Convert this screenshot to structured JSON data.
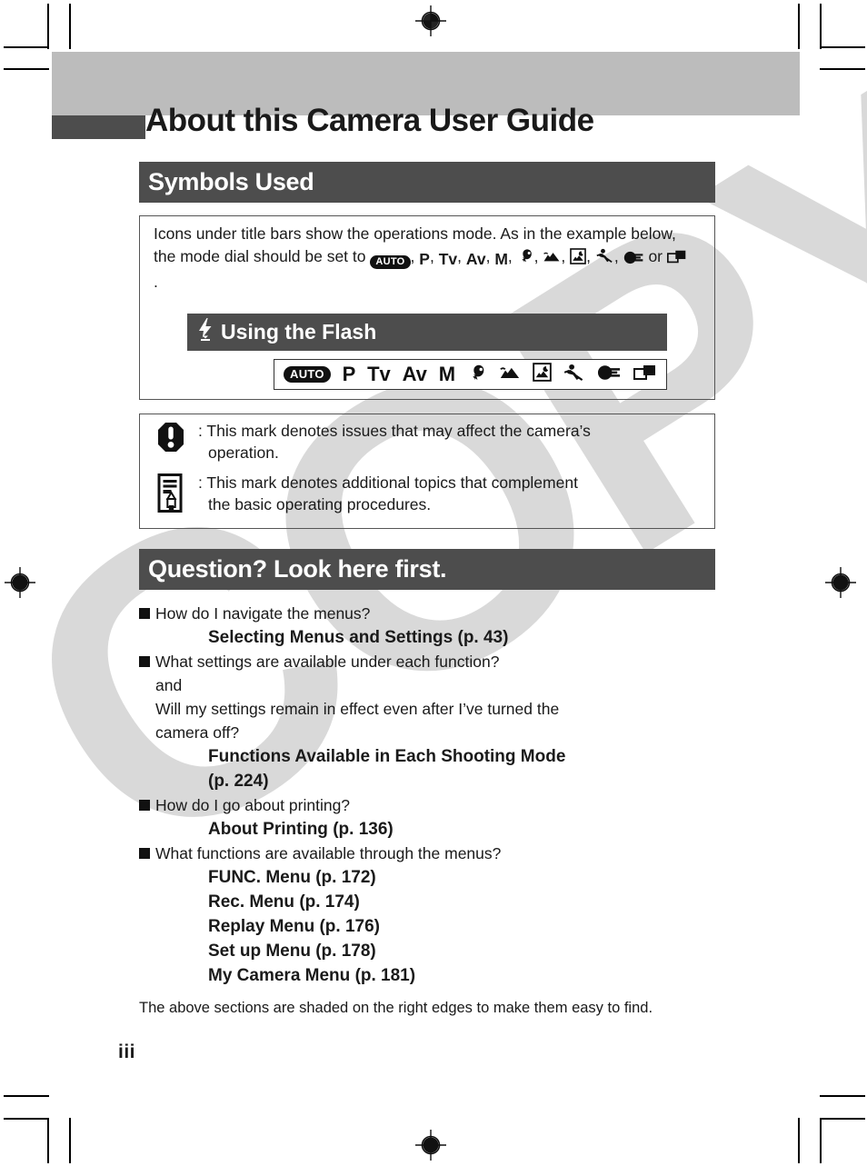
{
  "page": {
    "title": "About this Camera User Guide",
    "folio": "iii",
    "watermark": "COPY"
  },
  "sections": {
    "symbols": {
      "bar_label": "Symbols Used",
      "intro_prefix": "Icons under title bars show the operations mode. As in the example below, the mode dial should be set to ",
      "intro_after_auto": ", ",
      "intro_mid": " or ",
      "intro_end": ".",
      "auto_label": "AUTO",
      "mode_text_labels": [
        "P",
        "Tv",
        "Av",
        "M"
      ],
      "example": {
        "bar_label": "Using the Flash",
        "flash_icon": "flash-icon",
        "modes": [
          {
            "name": "auto-mode-icon",
            "label": "AUTO",
            "kind": "pill"
          },
          {
            "name": "program-mode-icon",
            "label": "P",
            "kind": "text"
          },
          {
            "name": "shutter-priority-mode-icon",
            "label": "Tv",
            "kind": "text"
          },
          {
            "name": "aperture-priority-mode-icon",
            "label": "Av",
            "kind": "text"
          },
          {
            "name": "manual-mode-icon",
            "label": "M",
            "kind": "text"
          },
          {
            "name": "portrait-mode-icon",
            "label": "",
            "kind": "glyph"
          },
          {
            "name": "landscape-mode-icon",
            "label": "",
            "kind": "glyph"
          },
          {
            "name": "night-scene-mode-icon",
            "label": "",
            "kind": "glyph"
          },
          {
            "name": "sports-mode-icon",
            "label": "",
            "kind": "glyph"
          },
          {
            "name": "movie-mode-icon",
            "label": "",
            "kind": "glyph"
          },
          {
            "name": "stitch-assist-mode-icon",
            "label": "",
            "kind": "glyph"
          }
        ]
      },
      "marks": [
        {
          "icon": "warning-icon",
          "line1": ": This mark denotes issues that may affect the camera’s",
          "line2": "operation."
        },
        {
          "icon": "note-icon",
          "line1": ": This mark denotes additional topics that complement",
          "line2": "the basic operating procedures."
        }
      ]
    },
    "question": {
      "bar_label": "Question? Look here first.",
      "items": [
        {
          "question": "How do I navigate the menus?",
          "extra": [],
          "answers": [
            {
              "title": "Selecting Menus and Settings",
              "page": "(p. 43)"
            }
          ]
        },
        {
          "question": "What settings are available under each function?",
          "extra": [
            "and",
            "Will my settings remain in effect even after I’ve turned the",
            "camera off?"
          ],
          "answers": [
            {
              "title": "Functions Available in Each Shooting Mode",
              "page": ""
            },
            {
              "title": "",
              "page": "(p. 224)"
            }
          ]
        },
        {
          "question": "How do I go about printing?",
          "extra": [],
          "answers": [
            {
              "title": "About Printing",
              "page": "(p. 136)"
            }
          ]
        },
        {
          "question": "What functions are available through the menus?",
          "extra": [],
          "answers": [
            {
              "title": "FUNC. Menu",
              "page": "(p. 172)"
            },
            {
              "title": "Rec. Menu",
              "page": "(p. 174)"
            },
            {
              "title": "Replay Menu",
              "page": "(p. 176)"
            },
            {
              "title": "Set up Menu",
              "page": "(p. 178)"
            },
            {
              "title": "My Camera Menu",
              "page": "(p. 181)"
            }
          ]
        }
      ],
      "footnote_line1": "The above sections are shaded on the right edges to make them",
      "footnote_line2": "easy to find."
    }
  },
  "colors": {
    "bar_dark": "#4d4d4d",
    "band_gray": "#bcbcbc",
    "watermark_gray": "#d9d9d9",
    "ink": "#1a1a1a"
  }
}
